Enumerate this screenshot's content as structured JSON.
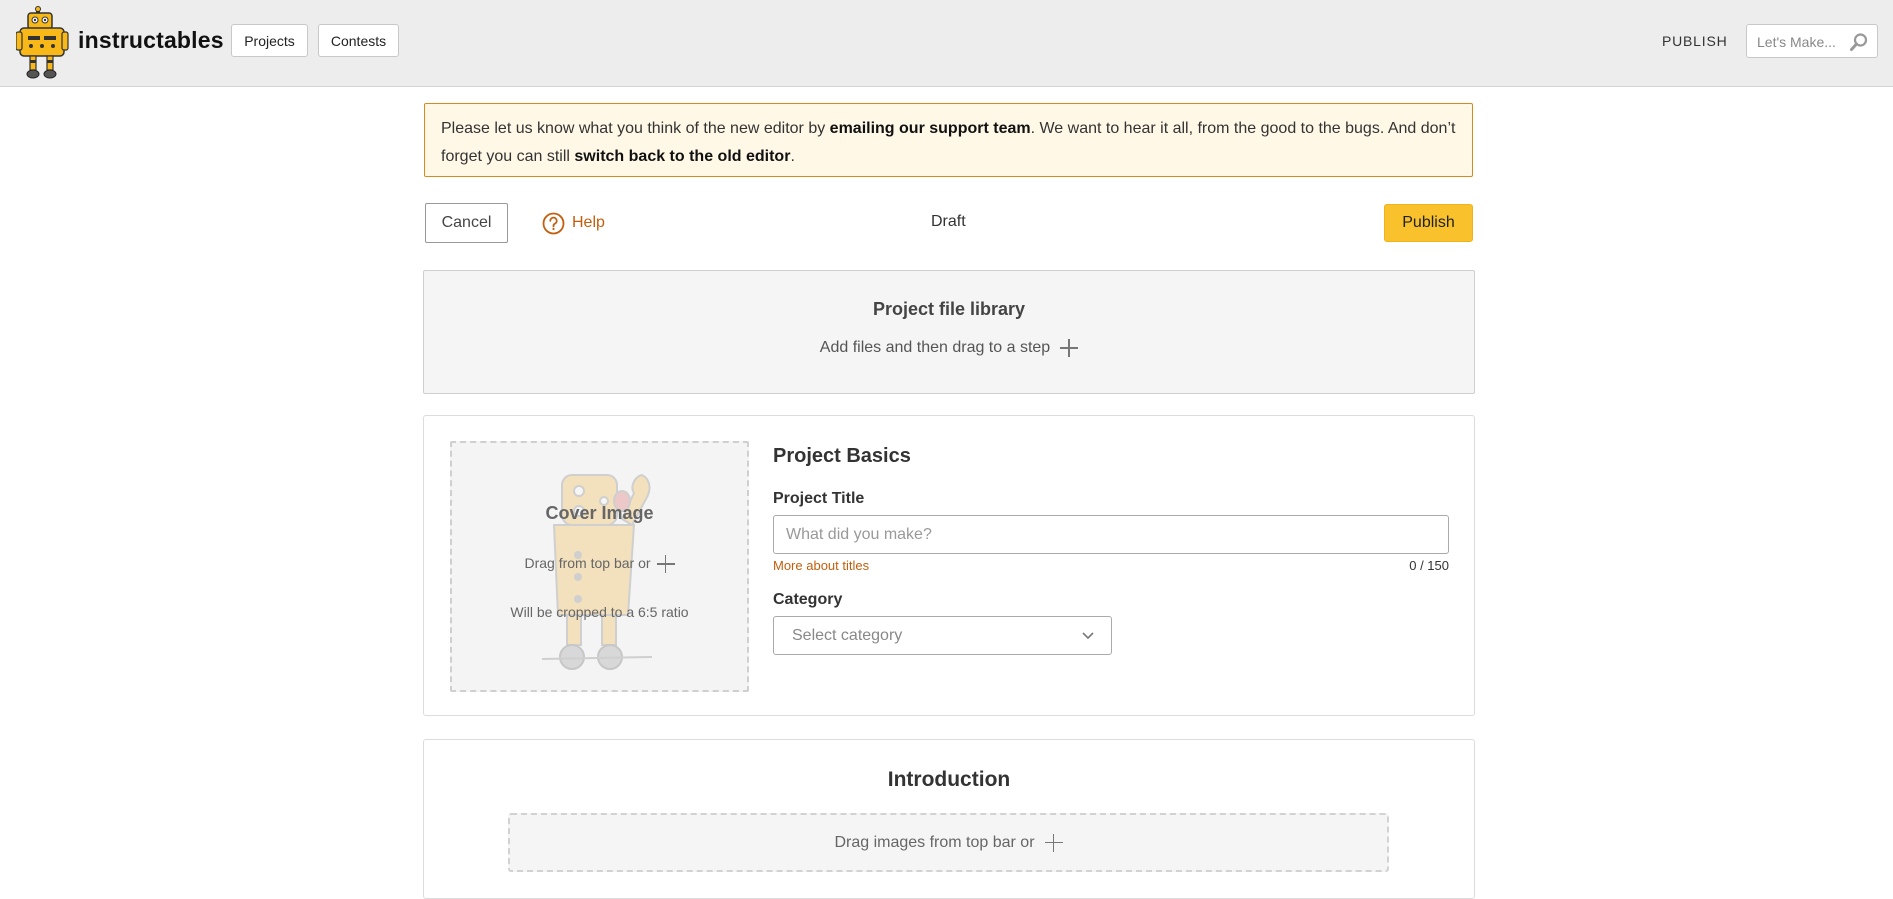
{
  "header": {
    "brand": "instructables",
    "nav": [
      {
        "label": "Projects"
      },
      {
        "label": "Contests"
      }
    ],
    "publish_link": "PUBLISH",
    "search_placeholder": "Let's Make..."
  },
  "notice": {
    "part1": "Please let us know what you think of the new editor by ",
    "link1": "emailing our support team",
    "part2": ". We want to hear it all, from the good to the bugs. And don’t forget you can still ",
    "link2": "switch back to the old editor",
    "part3": "."
  },
  "toolbar": {
    "cancel": "Cancel",
    "help": "Help",
    "status": "Draft",
    "publish": "Publish"
  },
  "library": {
    "title": "Project file library",
    "subtitle": "Add files and then drag to a step"
  },
  "basics": {
    "cover": {
      "title": "Cover Image",
      "drag_text": "Drag from top bar or",
      "ratio_text": "Will be cropped to a 6:5 ratio"
    },
    "title": "Project Basics",
    "project_title_label": "Project Title",
    "project_title_value": "",
    "project_title_placeholder": "What did you make?",
    "more_about_titles": "More about titles",
    "counter": "0 / 150",
    "category_label": "Category",
    "category_value": "Select category"
  },
  "introduction": {
    "title": "Introduction",
    "drop_text": "Drag images from top bar or"
  },
  "colors": {
    "accent": "#f9c22d",
    "link_orange": "#c25f0e",
    "notice_bg": "#fff8e7",
    "notice_border": "#d98a1f"
  }
}
